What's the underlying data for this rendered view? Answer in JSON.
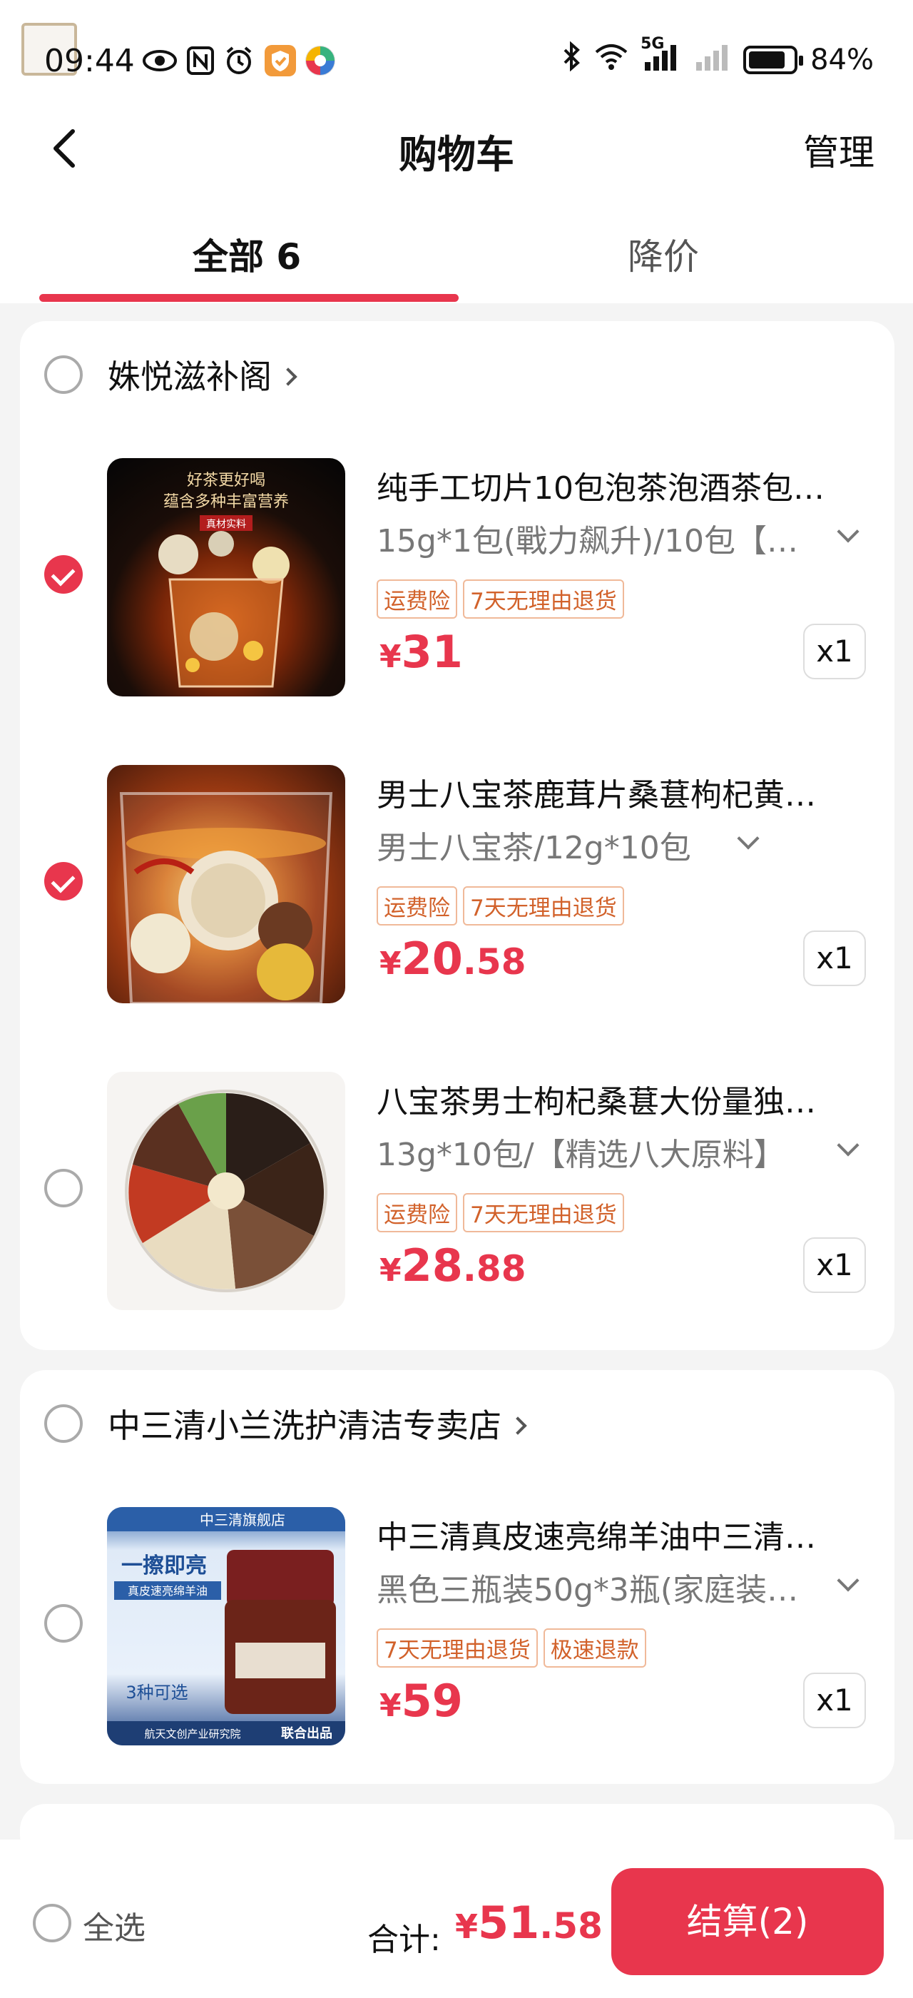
{
  "status_bar": {
    "time": "09:44",
    "battery": "84%",
    "battery_level": 0.84,
    "network": "5G",
    "icons": [
      "eye-icon",
      "nfc-icon",
      "alarm-icon",
      "shield-app-icon",
      "color-app-icon",
      "bluetooth-icon",
      "wifi-icon",
      "signal-icon",
      "signal-weak-icon",
      "battery-icon"
    ]
  },
  "header": {
    "title": "购物车",
    "manage_label": "管理"
  },
  "tabs": [
    {
      "label": "全部 6",
      "active": true
    },
    {
      "label": "降价",
      "active": false
    }
  ],
  "shops": [
    {
      "name": "姝悦滋补阁",
      "items": [
        {
          "name": "纯手工切片10包泡茶泡酒茶包…",
          "spec": "15g*1包(戰力飙升)/10包【…",
          "tags": [
            "运费险",
            "7天无理由退货"
          ],
          "price_currency": "¥",
          "price_int": "31",
          "price_dec": "",
          "qty": "x1",
          "checked": true,
          "image_texts": [
            "好茶更好喝",
            "蕴含多种丰富营养",
            "真材实料"
          ]
        },
        {
          "name": "男士八宝茶鹿茸片桑葚枸杞黄…",
          "spec": "男士八宝茶/12g*10包",
          "tags": [
            "运费险",
            "7天无理由退货"
          ],
          "price_currency": "¥",
          "price_int": "20",
          "price_dec": ".58",
          "qty": "x1",
          "checked": true
        },
        {
          "name": "八宝茶男士枸杞桑葚大份量独…",
          "spec": "13g*10包/【精选八大原料】",
          "tags": [
            "运费险",
            "7天无理由退货"
          ],
          "price_currency": "¥",
          "price_int": "28",
          "price_dec": ".88",
          "qty": "x1",
          "checked": false
        }
      ]
    },
    {
      "name": "中三清小兰洗护清洁专卖店",
      "items": [
        {
          "name": "中三清真皮速亮绵羊油中三清…",
          "spec": "黑色三瓶装50g*3瓶(家庭装…",
          "tags": [
            "7天无理由退货",
            "极速退款"
          ],
          "price_currency": "¥",
          "price_int": "59",
          "price_dec": "",
          "qty": "x1",
          "checked": false,
          "image_texts": [
            "中三清旗舰店",
            "一擦即亮",
            "真皮速亮绵羊油",
            "3种可选",
            "航天文创产业研究院",
            "联合出品"
          ]
        }
      ]
    }
  ],
  "bottom_bar": {
    "select_all_label": "全选",
    "total_label": "合计:",
    "total_currency": "¥",
    "total_int": "51",
    "total_dec": ".58",
    "checkout_label": "结算(2)"
  },
  "colors": {
    "accent": "#e8364d",
    "tag_text": "#d2622b",
    "background": "#f4f4f4"
  }
}
